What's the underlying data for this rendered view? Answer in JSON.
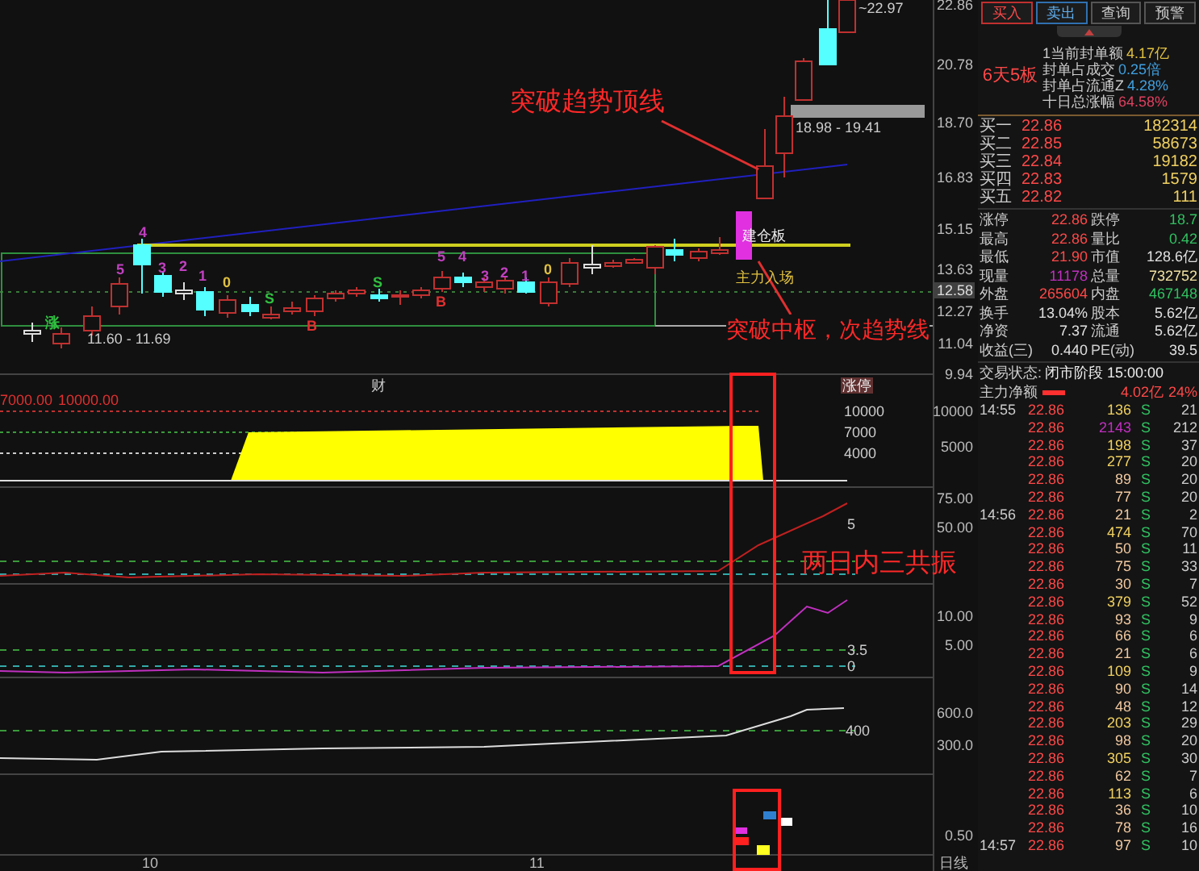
{
  "main_chart": {
    "axis_labels": [
      {
        "text": "22.86",
        "kind": "tick"
      },
      {
        "text": "20.78",
        "kind": "tick"
      },
      {
        "text": "18.70",
        "kind": "tick"
      },
      {
        "text": "16.83",
        "kind": "tick"
      },
      {
        "text": "15.15",
        "kind": "tick"
      },
      {
        "text": "13.63",
        "kind": "tick"
      },
      {
        "text": "12.58",
        "kind": "tag"
      },
      {
        "text": "12.27",
        "kind": "tick"
      },
      {
        "text": "11.04",
        "kind": "tick"
      },
      {
        "text": "9.94",
        "kind": "tick"
      }
    ],
    "annotations": [
      "突破趋势顶线",
      "突破中枢，次趋势线"
    ],
    "range_labels": [
      "~22.97",
      "18.98 - 19.41",
      "11.60 - 11.69"
    ],
    "signals": [
      "建仓板",
      "主力入场"
    ],
    "candle_marks": [
      {
        "text": "涨",
        "color": "#30c040"
      },
      {
        "text": "4",
        "color": "#c040c0"
      },
      {
        "text": "5",
        "color": "#c040c0"
      },
      {
        "text": "3",
        "color": "#c040c0"
      },
      {
        "text": "2",
        "color": "#c040c0"
      },
      {
        "text": "1",
        "color": "#c040c0"
      },
      {
        "text": "0",
        "color": "#e0c040"
      },
      {
        "text": "S",
        "color": "#30c040"
      },
      {
        "text": "B",
        "color": "#e03030"
      },
      {
        "text": "S",
        "color": "#30c040"
      },
      {
        "text": "B",
        "color": "#e03030"
      },
      {
        "text": "5",
        "color": "#c040c0"
      },
      {
        "text": "4",
        "color": "#c040c0"
      },
      {
        "text": "3",
        "color": "#c040c0"
      },
      {
        "text": "2",
        "color": "#c040c0"
      },
      {
        "text": "1",
        "color": "#c040c0"
      },
      {
        "text": "0",
        "color": "#e0c040"
      }
    ]
  },
  "volume_panel": {
    "header": [
      "7000.00",
      "10000.00"
    ],
    "tags": [
      "财",
      "涨停"
    ],
    "levels": [
      "10000",
      "7000",
      "4000"
    ],
    "axis_labels": [
      "10000",
      "5000"
    ]
  },
  "panel_2": {
    "axis_labels": [
      "75.00",
      "50.00"
    ],
    "annotation": "两日内三共振",
    "level_label": "5"
  },
  "panel_3": {
    "axis_labels": [
      "10.00",
      "5.00"
    ],
    "level_labels": [
      "3.5",
      "0"
    ]
  },
  "panel_4": {
    "axis_labels": [
      "600.0",
      "300.0"
    ],
    "level_label": "400"
  },
  "panel_5": {
    "axis_labels": [
      "0.50"
    ]
  },
  "x_axis": {
    "labels": [
      "10",
      "11"
    ],
    "period": "日线"
  },
  "trade_panel": {
    "buttons": [
      {
        "label": "买入",
        "kind": "buy"
      },
      {
        "label": "卖出",
        "kind": "sell"
      },
      {
        "label": "查询",
        "kind": "plain"
      },
      {
        "label": "预警",
        "kind": "plain"
      }
    ],
    "board_badge": "6天5板",
    "info": [
      {
        "label": "1当前封单额",
        "value": "4.17亿",
        "color": "#e0c040"
      },
      {
        "label": "封单占成交",
        "value": "0.25倍",
        "color": "#40a0e0"
      },
      {
        "label": "封单占流通Z",
        "value": "4.28%",
        "color": "#40a0e0"
      },
      {
        "label": "十日总涨幅",
        "value": "64.58%",
        "color": "#e04060"
      }
    ],
    "order_book": [
      {
        "label": "买一",
        "price": "22.86",
        "volume": "182314"
      },
      {
        "label": "买二",
        "price": "22.85",
        "volume": "58673"
      },
      {
        "label": "买三",
        "price": "22.84",
        "volume": "19182"
      },
      {
        "label": "买四",
        "price": "22.83",
        "volume": "1579"
      },
      {
        "label": "买五",
        "price": "22.82",
        "volume": "111"
      }
    ],
    "stats": [
      {
        "cells": [
          {
            "label": "涨停",
            "value": "22.86",
            "color": "#ff4848"
          },
          {
            "label": "跌停",
            "value": "18.7",
            "color": "#30c060"
          }
        ]
      },
      {
        "cells": [
          {
            "label": "最高",
            "value": "22.86",
            "color": "#ff4848"
          },
          {
            "label": "量比",
            "value": "0.42",
            "color": "#30c060"
          }
        ]
      },
      {
        "cells": [
          {
            "label": "最低",
            "value": "21.90",
            "color": "#ff4848"
          },
          {
            "label": "市值",
            "value": "128.6亿",
            "color": "#e0e0e0"
          }
        ]
      },
      {
        "cells": [
          {
            "label": "现量",
            "value": "11178",
            "color": "#c030c0"
          },
          {
            "label": "总量",
            "value": "732752",
            "color": "#f0e0a0"
          }
        ]
      },
      {
        "cells": [
          {
            "label": "外盘",
            "value": "265604",
            "color": "#ff4848"
          },
          {
            "label": "内盘",
            "value": "467148",
            "color": "#30c060"
          }
        ]
      },
      {
        "cells": [
          {
            "label": "换手",
            "value": "13.04%",
            "color": "#e0e0e0"
          },
          {
            "label": "股本",
            "value": "5.62亿",
            "color": "#e0e0e0"
          }
        ]
      },
      {
        "cells": [
          {
            "label": "净资",
            "value": "7.37",
            "color": "#e0e0e0"
          },
          {
            "label": "流通",
            "value": "5.62亿",
            "color": "#e0e0e0"
          }
        ]
      },
      {
        "cells": [
          {
            "label": "收益(三)",
            "value": "0.440",
            "color": "#e0e0e0"
          },
          {
            "label": "PE(动)",
            "value": "39.5",
            "color": "#e0e0e0"
          }
        ]
      }
    ],
    "trade_status": {
      "label": "交易状态:",
      "value": "闭市阶段 15:00:00"
    },
    "net_flow": {
      "label": "主力净额",
      "value": "4.02亿",
      "percent": "24%"
    },
    "ticks": [
      {
        "time": "14:55",
        "price": "22.86",
        "volume": "136",
        "color": "#f0d060",
        "side": "S",
        "column_5": "21"
      },
      {
        "price": "22.86",
        "volume": "2143",
        "color": "#c030c0",
        "side": "S",
        "column_5": "212"
      },
      {
        "price": "22.86",
        "volume": "198",
        "color": "#f0d060",
        "side": "S",
        "column_5": "37"
      },
      {
        "price": "22.86",
        "volume": "277",
        "color": "#f0d060",
        "side": "S",
        "column_5": "20"
      },
      {
        "price": "22.86",
        "volume": "89",
        "color": "#f0c8a0",
        "side": "S",
        "column_5": "20"
      },
      {
        "price": "22.86",
        "volume": "77",
        "color": "#f0c8a0",
        "side": "S",
        "column_5": "20"
      },
      {
        "time": "14:56",
        "price": "22.86",
        "volume": "21",
        "color": "#f0c8a0",
        "side": "S",
        "column_5": "2"
      },
      {
        "price": "22.86",
        "volume": "474",
        "color": "#f0d060",
        "side": "S",
        "column_5": "70"
      },
      {
        "price": "22.86",
        "volume": "50",
        "color": "#f0c8a0",
        "side": "S",
        "column_5": "11"
      },
      {
        "price": "22.86",
        "volume": "75",
        "color": "#f0c8a0",
        "side": "S",
        "column_5": "33"
      },
      {
        "price": "22.86",
        "volume": "30",
        "color": "#f0c8a0",
        "side": "S",
        "column_5": "7"
      },
      {
        "price": "22.86",
        "volume": "379",
        "color": "#f0d060",
        "side": "S",
        "column_5": "52"
      },
      {
        "price": "22.86",
        "volume": "93",
        "color": "#f0c8a0",
        "side": "S",
        "column_5": "9"
      },
      {
        "price": "22.86",
        "volume": "66",
        "color": "#f0c8a0",
        "side": "S",
        "column_5": "6"
      },
      {
        "price": "22.86",
        "volume": "21",
        "color": "#f0c8a0",
        "side": "S",
        "column_5": "6"
      },
      {
        "price": "22.86",
        "volume": "109",
        "color": "#f0d060",
        "side": "S",
        "column_5": "9"
      },
      {
        "price": "22.86",
        "volume": "90",
        "color": "#f0c8a0",
        "side": "S",
        "column_5": "14"
      },
      {
        "price": "22.86",
        "volume": "48",
        "color": "#f0c8a0",
        "side": "S",
        "column_5": "12"
      },
      {
        "price": "22.86",
        "volume": "203",
        "color": "#f0d060",
        "side": "S",
        "column_5": "29"
      },
      {
        "price": "22.86",
        "volume": "98",
        "color": "#f0c8a0",
        "side": "S",
        "column_5": "20"
      },
      {
        "price": "22.86",
        "volume": "305",
        "color": "#f0d060",
        "side": "S",
        "column_5": "30"
      },
      {
        "price": "22.86",
        "volume": "62",
        "color": "#f0c8a0",
        "side": "S",
        "column_5": "7"
      },
      {
        "price": "22.86",
        "volume": "113",
        "color": "#f0d060",
        "side": "S",
        "column_5": "6"
      },
      {
        "price": "22.86",
        "volume": "36",
        "color": "#f0c8a0",
        "side": "S",
        "column_5": "10"
      },
      {
        "price": "22.86",
        "volume": "78",
        "color": "#f0c8a0",
        "side": "S",
        "column_5": "16"
      },
      {
        "time": "14:57",
        "price": "22.86",
        "volume": "97",
        "color": "#f0c8a0",
        "side": "S",
        "column_5": "10"
      }
    ]
  }
}
